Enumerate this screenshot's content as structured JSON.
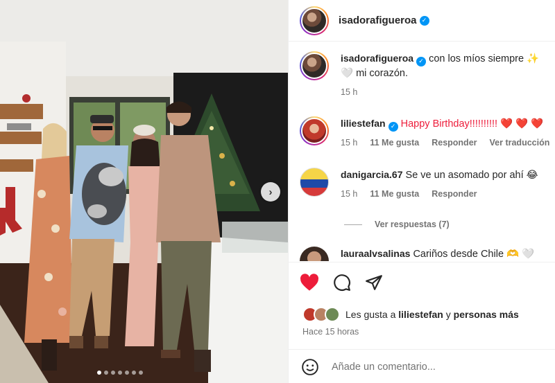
{
  "post": {
    "author": "isadorafigueroa",
    "slide_count": 7,
    "active_slide": 1
  },
  "caption": {
    "username": "isadorafigueroa",
    "text": "con los míos siempre ✨ 🤍 mi corazón.",
    "time": "15 h"
  },
  "comments": [
    {
      "username": "liliestefan",
      "verified": true,
      "text": "Happy Birthday!!!!!!!!!! ❤️ ❤️ ❤️",
      "time": "15 h",
      "likes": "11 Me gusta",
      "reply": "Responder",
      "translate": "Ver traducción"
    },
    {
      "username": "danigarcia.67",
      "verified": false,
      "text": "Se ve un asomado por ahí 😂",
      "time": "15 h",
      "likes": "11 Me gusta",
      "reply": "Responder"
    },
    {
      "username": "lauraalvsalinas",
      "verified": false,
      "text": "Cariños desde Chile 🫶 🤍"
    }
  ],
  "view_replies": "Ver respuestas (7)",
  "likes_summary": {
    "prefix": "Les gusta a",
    "user": "liliestefan",
    "connector": "y",
    "rest": "personas más"
  },
  "timestamp": "Hace 15 horas",
  "add_comment_placeholder": "Añade un comentario...",
  "icons": {
    "like": "heart-filled-icon",
    "comment": "comment-bubble-icon",
    "share": "paper-plane-icon",
    "emoji": "smiley-icon",
    "next": "chevron-right-icon"
  },
  "colors": {
    "like_red": "#ed1c3a",
    "verified_blue": "#0095f6",
    "secondary_text": "#737373"
  }
}
